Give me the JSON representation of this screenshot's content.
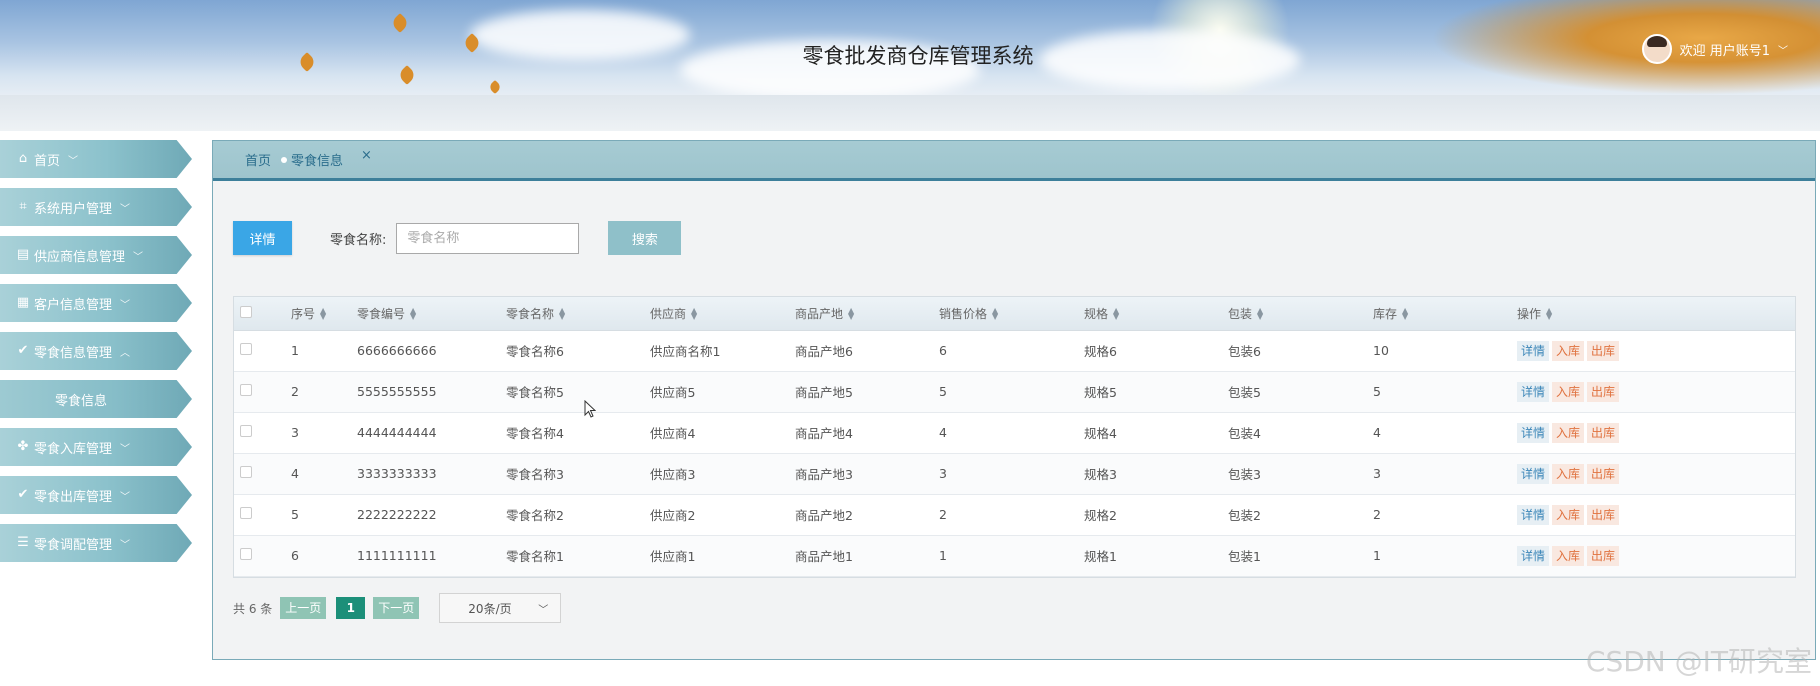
{
  "header": {
    "title": "零食批发商仓库管理系统",
    "welcome": "欢迎 用户账号1",
    "avatar_icon": "user-avatar-icon"
  },
  "sidebar": {
    "items": [
      {
        "label": "首页",
        "icon": "home-icon",
        "glyph": "⌂"
      },
      {
        "label": "系统用户管理",
        "icon": "crop-icon",
        "glyph": "⌗"
      },
      {
        "label": "供应商信息管理",
        "icon": "cards-icon",
        "glyph": "▤"
      },
      {
        "label": "客户信息管理",
        "icon": "grid-icon",
        "glyph": "▦"
      },
      {
        "label": "零食信息管理",
        "icon": "check-circle-icon",
        "glyph": "✔"
      },
      {
        "label": "零食入库管理",
        "icon": "apps-icon",
        "glyph": "✤"
      },
      {
        "label": "零食出库管理",
        "icon": "check-circle-icon",
        "glyph": "✔"
      },
      {
        "label": "零食调配管理",
        "icon": "list-icon",
        "glyph": "☰"
      }
    ],
    "sub_item": "零食信息"
  },
  "tabs": {
    "home": "首页",
    "active": "零食信息",
    "close": "×"
  },
  "toolbar": {
    "detail_label": "详情",
    "search_label": "零食名称:",
    "search_placeholder": "零食名称",
    "search_button": "搜索"
  },
  "table": {
    "columns": [
      "序号",
      "零食编号",
      "零食名称",
      "供应商",
      "商品产地",
      "销售价格",
      "规格",
      "包装",
      "库存",
      "操作"
    ],
    "rows": [
      {
        "no": "1",
        "code": "6666666666",
        "name": "零食名称6",
        "supplier": "供应商名称1",
        "origin": "商品产地6",
        "price": "6",
        "spec": "规格6",
        "pack": "包装6",
        "stock": "10"
      },
      {
        "no": "2",
        "code": "5555555555",
        "name": "零食名称5",
        "supplier": "供应商5",
        "origin": "商品产地5",
        "price": "5",
        "spec": "规格5",
        "pack": "包装5",
        "stock": "5"
      },
      {
        "no": "3",
        "code": "4444444444",
        "name": "零食名称4",
        "supplier": "供应商4",
        "origin": "商品产地4",
        "price": "4",
        "spec": "规格4",
        "pack": "包装4",
        "stock": "4"
      },
      {
        "no": "4",
        "code": "3333333333",
        "name": "零食名称3",
        "supplier": "供应商3",
        "origin": "商品产地3",
        "price": "3",
        "spec": "规格3",
        "pack": "包装3",
        "stock": "3"
      },
      {
        "no": "5",
        "code": "2222222222",
        "name": "零食名称2",
        "supplier": "供应商2",
        "origin": "商品产地2",
        "price": "2",
        "spec": "规格2",
        "pack": "包装2",
        "stock": "2"
      },
      {
        "no": "6",
        "code": "1111111111",
        "name": "零食名称1",
        "supplier": "供应商1",
        "origin": "商品产地1",
        "price": "1",
        "spec": "规格1",
        "pack": "包装1",
        "stock": "1"
      }
    ],
    "ops": {
      "detail": "详情",
      "in": "入库",
      "out": "出库"
    }
  },
  "pager": {
    "total": "共 6 条",
    "prev": "上一页",
    "current": "1",
    "next": "下一页",
    "page_size": "20条/页"
  },
  "watermark": "CSDN @IT研究室",
  "colors": {
    "accent_blue": "#3aa6e6",
    "sidebar_teal": "#8cc2cc",
    "page_active": "#1c8f79",
    "op_orange": "#e0723f"
  }
}
